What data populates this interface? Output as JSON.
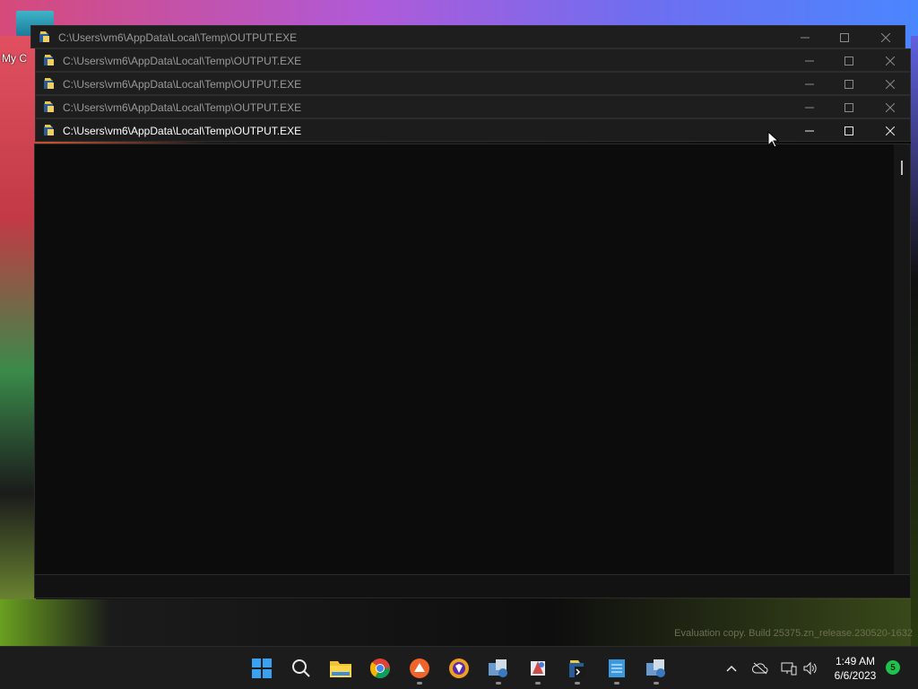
{
  "desktop": {
    "label": "My C",
    "build_watermark": "Evaluation copy. Build 25375.zn_release.230520-1632"
  },
  "windows": [
    {
      "title": "C:\\Users\\vm6\\AppData\\Local\\Temp\\OUTPUT.EXE",
      "active": false
    },
    {
      "title": "C:\\Users\\vm6\\AppData\\Local\\Temp\\OUTPUT.EXE",
      "active": false
    },
    {
      "title": "C:\\Users\\vm6\\AppData\\Local\\Temp\\OUTPUT.EXE",
      "active": false
    },
    {
      "title": "C:\\Users\\vm6\\AppData\\Local\\Temp\\OUTPUT.EXE",
      "active": false
    },
    {
      "title": "C:\\Users\\vm6\\AppData\\Local\\Temp\\OUTPUT.EXE",
      "active": true
    }
  ],
  "taskbar": {
    "apps": [
      "start-icon",
      "search-icon",
      "file-explorer-icon",
      "chrome-icon",
      "app-orange-icon",
      "app-shield-icon",
      "app-setup-icon",
      "app-paint-icon",
      "app-console-icon",
      "notepad-icon",
      "app-setup2-icon"
    ],
    "tray": {
      "time": "1:49 AM",
      "date": "6/6/2023",
      "notification_count": "5"
    }
  },
  "colors": {
    "titlebar": "#1e1e1e",
    "console_bg": "#0c0c0c",
    "taskbar": "#1c1c1c",
    "accent_green": "#1fc24a"
  }
}
